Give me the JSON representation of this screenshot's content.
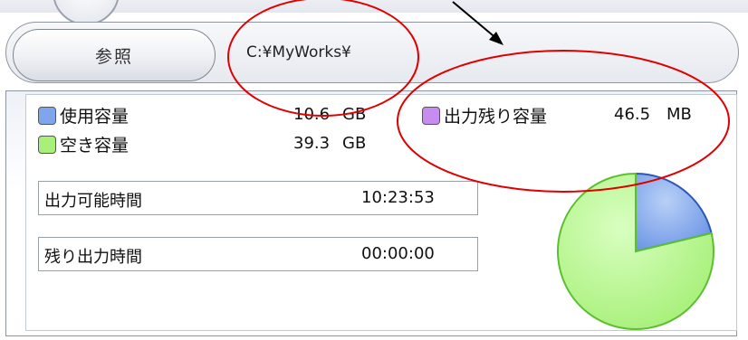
{
  "toolbar": {
    "browse_label": "参照",
    "path_value": "C:¥MyWorks¥"
  },
  "capacity": {
    "used_label": "使用容量",
    "used_value": "10.6",
    "used_unit": "GB",
    "free_label": "空き容量",
    "free_value": "39.3",
    "free_unit": "GB",
    "remaining_label": "出力残り容量",
    "remaining_value": "46.5",
    "remaining_unit": "MB"
  },
  "times": {
    "available_label": "出力可能時間",
    "available_value": "10:23:53",
    "remaining_label": "残り出力時間",
    "remaining_value": "00:00:00"
  },
  "colors": {
    "used": "#7fa6ec",
    "free": "#a8f07a",
    "remaining": "#c78cf0",
    "annotation": "#e00000"
  },
  "chart_data": {
    "type": "pie",
    "categories": [
      "使用容量",
      "空き容量"
    ],
    "values": [
      10.6,
      39.3
    ]
  }
}
